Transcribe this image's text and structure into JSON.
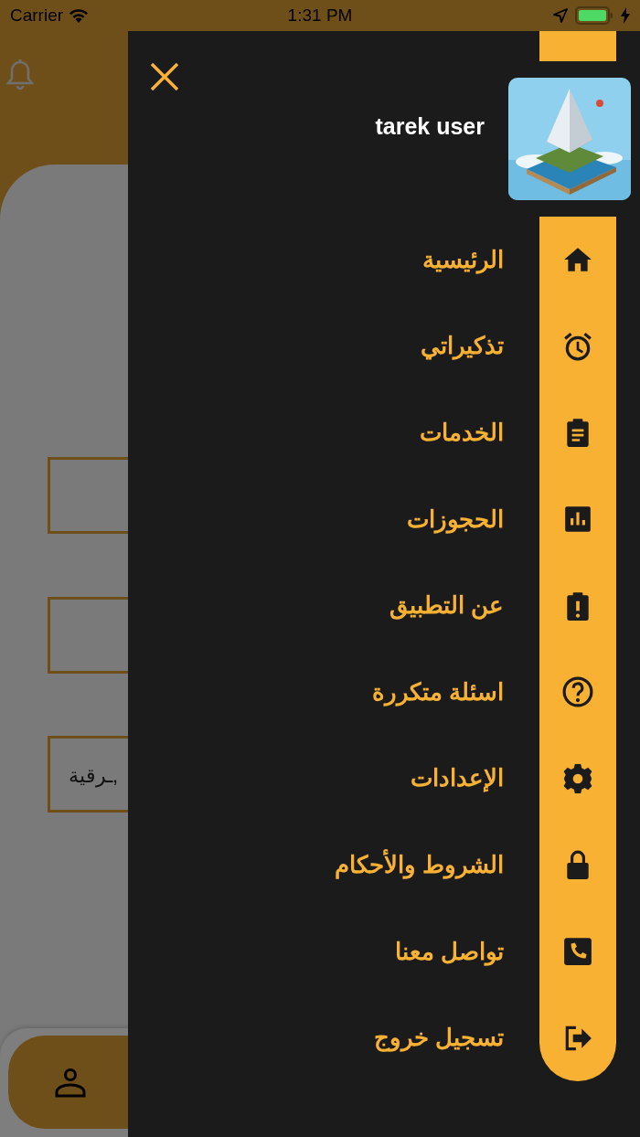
{
  "status_bar": {
    "carrier": "Carrier",
    "time": "1:31 PM"
  },
  "background": {
    "field_text": "ـرقية,"
  },
  "drawer": {
    "user_name": "tarek user",
    "items": [
      {
        "label": "الرئيسية"
      },
      {
        "label": "تذكيراتي"
      },
      {
        "label": "الخدمات"
      },
      {
        "label": "الحجوزات"
      },
      {
        "label": "عن التطبيق"
      },
      {
        "label": "اسئلة متكررة"
      },
      {
        "label": "الإعدادات"
      },
      {
        "label": "الشروط والأحكام"
      },
      {
        "label": "تواصل معنا"
      },
      {
        "label": "تسجيل خروج"
      }
    ]
  }
}
